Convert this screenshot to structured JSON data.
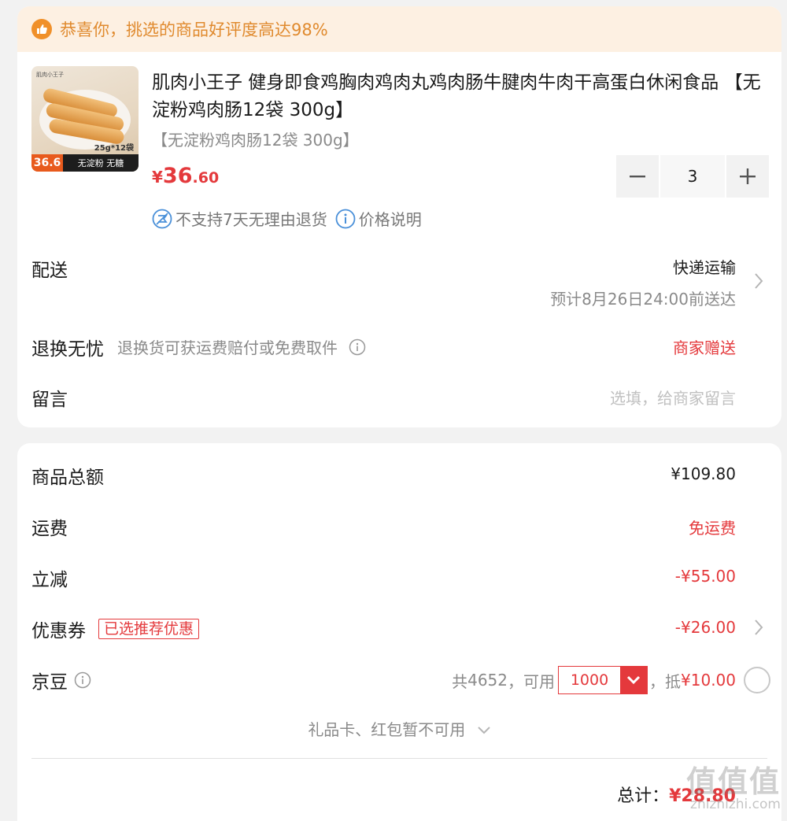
{
  "banner": {
    "text": "恭喜你，挑选的商品好评度高达98%",
    "icon": "thumbs-up-icon"
  },
  "product": {
    "thumb": {
      "tag": "36.6",
      "strip": "无淀粉 无糖",
      "pack": "25g*12袋",
      "logo": "肌肉小王子"
    },
    "title": "肌肉小王子 健身即食鸡胸肉鸡肉丸鸡肉肠牛腱肉牛肉干高蛋白休闲食品 【无淀粉鸡肉肠12袋 300g】",
    "spec": "【无淀粉鸡肉肠12袋 300g】",
    "price": {
      "currency": "¥",
      "integer": "36",
      "decimal": ".60"
    },
    "quantity": "3",
    "notes": {
      "no_return": "不支持7天无理由退货",
      "price_info": "价格说明"
    }
  },
  "delivery": {
    "label": "配送",
    "method": "快递运输",
    "eta": "预计8月26日24:00前送达"
  },
  "return": {
    "label": "退换无忧",
    "desc": "退换货可获运费赔付或免费取件",
    "value": "商家赠送"
  },
  "message": {
    "label": "留言",
    "placeholder": "选填，给商家留言"
  },
  "summary": {
    "goods_total": {
      "label": "商品总额",
      "value": "¥109.80"
    },
    "shipping": {
      "label": "运费",
      "value": "免运费"
    },
    "discount": {
      "label": "立减",
      "value": "-¥55.00"
    },
    "coupon": {
      "label": "优惠券",
      "tag": "已选推荐优惠",
      "value": "-¥26.00"
    },
    "jingdou": {
      "label": "京豆",
      "total_prefix": "共",
      "total": "4652",
      "usable": "，可用",
      "amount": "1000",
      "deduct_prefix": "，抵",
      "deduct": "¥10.00"
    },
    "giftcard": "礼品卡、红包暂不可用",
    "total": {
      "label": "总计：",
      "value": "¥28.80"
    }
  },
  "watermark": {
    "chars": "值值值",
    "url": "zhizhizhi.com"
  },
  "colors": {
    "accent_red": "#e4393c",
    "banner_bg": "#fdf0e2",
    "banner_text": "#e08a2e"
  }
}
